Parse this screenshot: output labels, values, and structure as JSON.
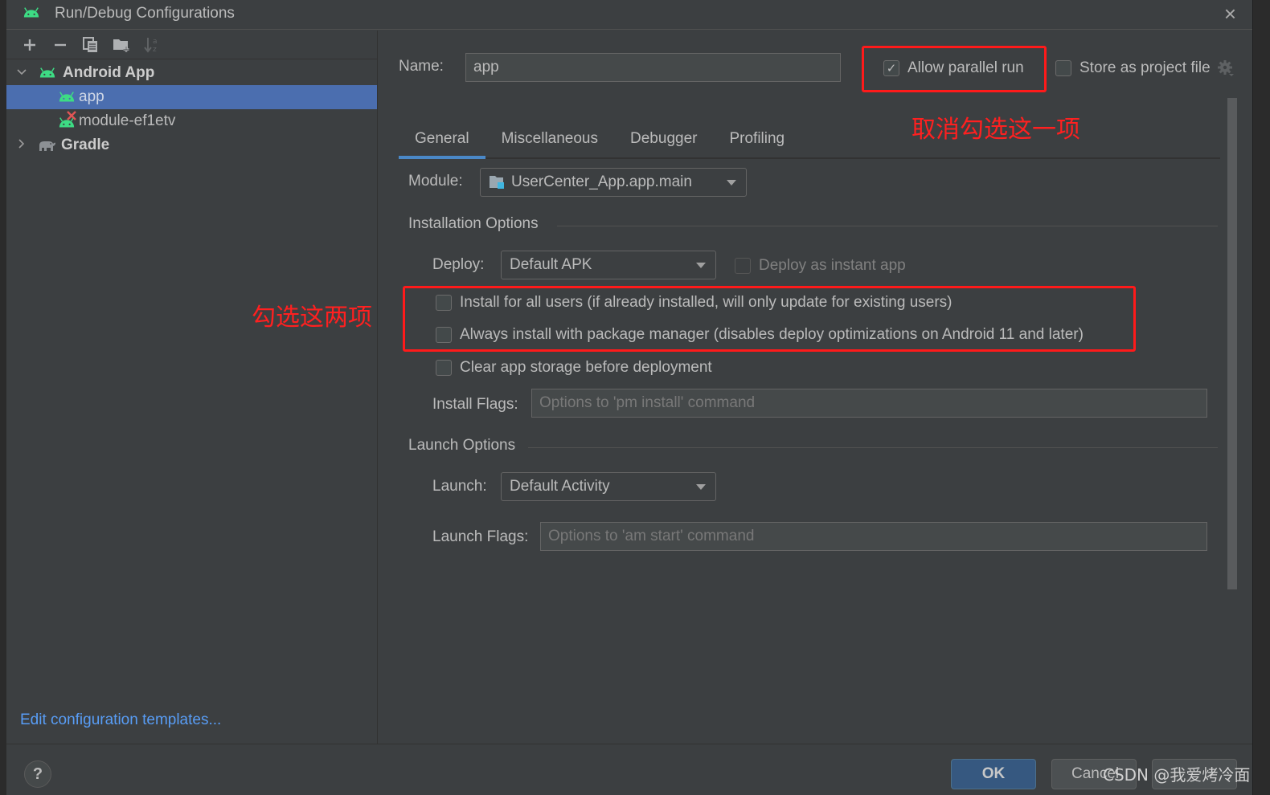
{
  "window": {
    "title": "Run/Debug Configurations",
    "close_label": "×"
  },
  "toolbar": {
    "add_label": "Add configuration",
    "remove_label": "Remove configuration",
    "copy_label": "Copy configuration",
    "new_folder_label": "New folder",
    "sort_label": "Sort alphabetically"
  },
  "tree": {
    "groups": [
      {
        "label": "Android App",
        "expanded": true,
        "items": [
          {
            "label": "app",
            "selected": true,
            "error": false
          },
          {
            "label": "module-ef1etv",
            "selected": false,
            "error": true
          }
        ]
      },
      {
        "label": "Gradle",
        "expanded": false,
        "items": []
      }
    ]
  },
  "edit_templates_link": "Edit configuration templates...",
  "config": {
    "name_label": "Name:",
    "name_value": "app",
    "allow_parallel_run": {
      "label": "Allow parallel run",
      "checked": true
    },
    "store_as_project_file": {
      "label": "Store as project file",
      "checked": false
    },
    "tabs": [
      {
        "label": "General",
        "active": true
      },
      {
        "label": "Miscellaneous",
        "active": false
      },
      {
        "label": "Debugger",
        "active": false
      },
      {
        "label": "Profiling",
        "active": false
      }
    ],
    "module_label": "Module:",
    "module_value": "UserCenter_App.app.main",
    "installation_options": {
      "title": "Installation Options",
      "deploy_label": "Deploy:",
      "deploy_value": "Default APK",
      "deploy_instant": {
        "label": "Deploy as instant app",
        "checked": false,
        "enabled": false
      },
      "install_all_users": {
        "label": "Install for all users (if already installed, will only update for existing users)",
        "checked": false
      },
      "always_install_pm": {
        "label": "Always install with package manager (disables deploy optimizations on Android 11 and later)",
        "checked": false
      },
      "clear_storage": {
        "label": "Clear app storage before deployment",
        "checked": false
      },
      "install_flags_label": "Install Flags:",
      "install_flags_placeholder": "Options to 'pm install' command"
    },
    "launch_options": {
      "title": "Launch Options",
      "launch_label": "Launch:",
      "launch_value": "Default Activity",
      "launch_flags_label": "Launch Flags:",
      "launch_flags_placeholder": "Options to 'am start' command"
    }
  },
  "annotations": {
    "uncheck_note": "取消勾选这一项",
    "check_note": "勾选这两项"
  },
  "buttons": {
    "help": "?",
    "ok": "OK",
    "cancel": "Cancel",
    "apply": "Apply"
  },
  "watermark": "CSDN @我爱烤冷面",
  "colors": {
    "android_green": "#3ddc84",
    "selection": "#4b6eaf",
    "link": "#589df6",
    "annotation_red": "#ff1a1a",
    "primary_button": "#365880"
  }
}
